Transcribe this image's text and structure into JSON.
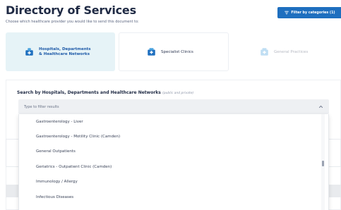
{
  "header": {
    "title": "Directory of Services",
    "subtitle": "Choose which healthcare provider you would like to send this document to:",
    "filter_button": "Filter by categories (1)"
  },
  "categories": [
    {
      "label": "Hospitals, Departments\n& Healthcare Networks",
      "selected": true,
      "icon": "hospital-icon"
    },
    {
      "label": "Specialist Clinics",
      "selected": false,
      "icon": "clinic-icon"
    },
    {
      "label": "General Practices",
      "selected": false,
      "icon": "practice-icon"
    }
  ],
  "search": {
    "heading": "Search by Hospitals, Departments and Healthcare Networks",
    "heading_note": "(public and private)",
    "placeholder": "Type to filter results"
  },
  "results": [
    "Gastroenterology - Liver",
    "Gastroenterology - Motility Clinic (Camden)",
    "General Outpatients",
    "Geriatrics - Outpatient Clinic (Camden)",
    "Immunology / Allergy",
    "Infectious Diseases"
  ],
  "colors": {
    "accent": "#1e6fbf",
    "selected_card": "#e6f3f7",
    "title": "#1f2a44"
  }
}
